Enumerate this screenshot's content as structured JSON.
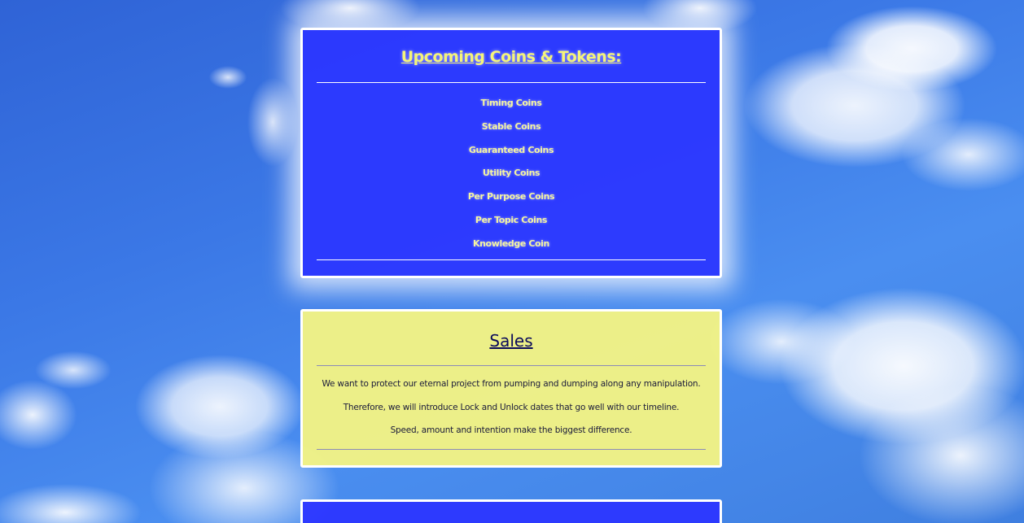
{
  "upcoming": {
    "title": "Upcoming Coins & Tokens:",
    "items": [
      "Timing Coins",
      "Stable Coins",
      "Guaranteed Coins",
      "Utility Coins",
      "Per Purpose Coins",
      "Per Topic Coins",
      "Knowledge Coin"
    ]
  },
  "sales": {
    "title": "Sales",
    "paragraphs": [
      "We want to protect our eternal project from pumping and dumping along any manipulation.",
      "Therefore, we will introduce Lock and Unlock dates that go well with our timeline.",
      "Speed, amount and intention make the biggest difference."
    ]
  },
  "colors": {
    "blue_panel": "#2c36ff",
    "yellow_panel": "#f7f582",
    "heading_yellow": "#f4f47a",
    "sales_heading": "#0b0b5a"
  }
}
